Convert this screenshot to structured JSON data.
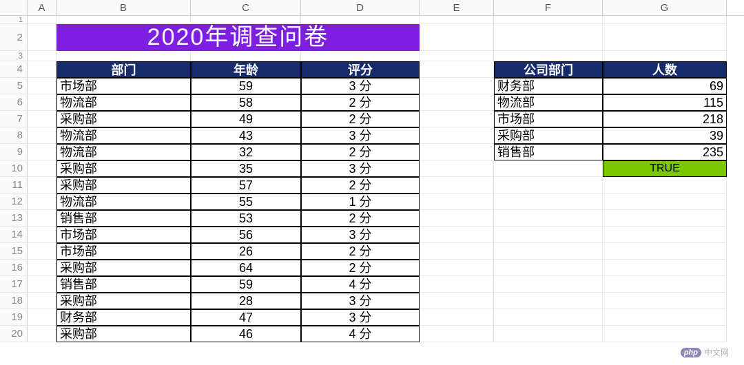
{
  "columns": [
    "A",
    "B",
    "C",
    "D",
    "E",
    "F",
    "G"
  ],
  "row_numbers": [
    1,
    2,
    3,
    4,
    5,
    6,
    7,
    8,
    9,
    10,
    11,
    12,
    13,
    14,
    15,
    16,
    17,
    18,
    19,
    20
  ],
  "title": "2020年调查问卷",
  "main": {
    "headers": {
      "dept": "部门",
      "age": "年龄",
      "score": "评分"
    },
    "rows": [
      {
        "dept": "市场部",
        "age": "59",
        "score": "3 分"
      },
      {
        "dept": "物流部",
        "age": "58",
        "score": "2 分"
      },
      {
        "dept": "采购部",
        "age": "49",
        "score": "2 分"
      },
      {
        "dept": "物流部",
        "age": "43",
        "score": "3 分"
      },
      {
        "dept": "物流部",
        "age": "32",
        "score": "2 分"
      },
      {
        "dept": "采购部",
        "age": "35",
        "score": "3 分"
      },
      {
        "dept": "采购部",
        "age": "57",
        "score": "2 分"
      },
      {
        "dept": "物流部",
        "age": "55",
        "score": "1 分"
      },
      {
        "dept": "销售部",
        "age": "53",
        "score": "2 分"
      },
      {
        "dept": "市场部",
        "age": "56",
        "score": "3 分"
      },
      {
        "dept": "市场部",
        "age": "26",
        "score": "2 分"
      },
      {
        "dept": "采购部",
        "age": "64",
        "score": "2 分"
      },
      {
        "dept": "销售部",
        "age": "59",
        "score": "4 分"
      },
      {
        "dept": "采购部",
        "age": "28",
        "score": "3 分"
      },
      {
        "dept": "财务部",
        "age": "47",
        "score": "3 分"
      },
      {
        "dept": "采购部",
        "age": "46",
        "score": "4 分"
      }
    ]
  },
  "side": {
    "headers": {
      "dept": "公司部门",
      "count": "人数"
    },
    "rows": [
      {
        "dept": "财务部",
        "count": "69"
      },
      {
        "dept": "物流部",
        "count": "115"
      },
      {
        "dept": "市场部",
        "count": "218"
      },
      {
        "dept": "采购部",
        "count": "39"
      },
      {
        "dept": "销售部",
        "count": "235"
      }
    ],
    "bool_cell": "TRUE"
  },
  "watermark": {
    "badge": "php",
    "text": "中文网"
  }
}
